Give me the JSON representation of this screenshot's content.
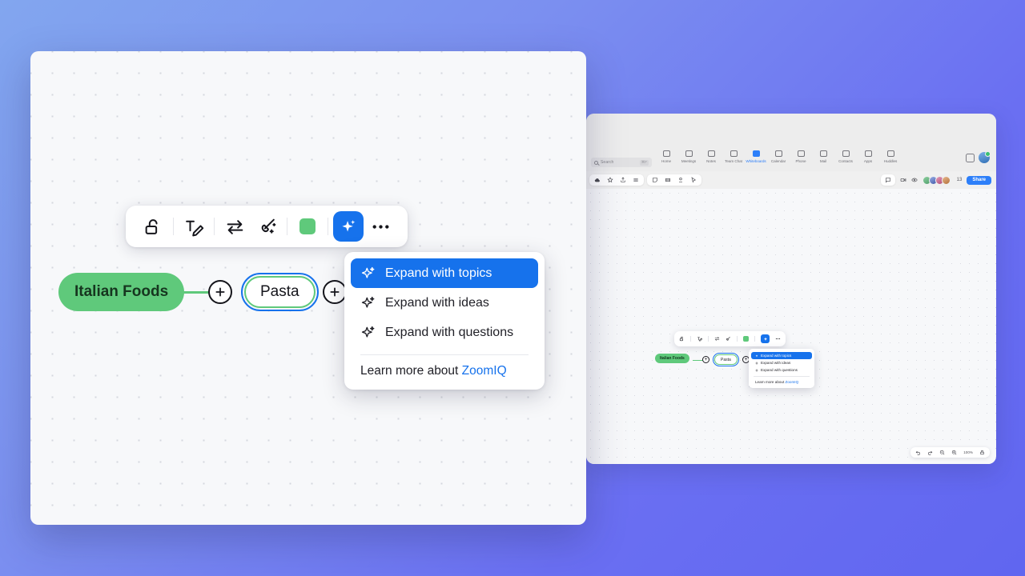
{
  "background_app": {
    "name": "zoom-desktop-app",
    "search": {
      "placeholder": "Search",
      "shortcut": "⌘F"
    },
    "nav_items": [
      {
        "label": "Home",
        "icon": "home-icon",
        "active": false
      },
      {
        "label": "Meetings",
        "icon": "video-icon",
        "active": false
      },
      {
        "label": "Notes",
        "icon": "notes-icon",
        "active": false
      },
      {
        "label": "Team Chat",
        "icon": "chat-icon",
        "active": false
      },
      {
        "label": "Whiteboards",
        "icon": "whiteboard-icon",
        "active": true
      },
      {
        "label": "Calendar",
        "icon": "calendar-icon",
        "active": false
      },
      {
        "label": "Phone",
        "icon": "phone-icon",
        "active": false
      },
      {
        "label": "Mail",
        "icon": "mail-icon",
        "active": false
      },
      {
        "label": "Contacts",
        "icon": "contacts-icon",
        "active": false
      },
      {
        "label": "Apps",
        "icon": "apps-icon",
        "active": false
      },
      {
        "label": "Huddles",
        "icon": "huddles-icon",
        "active": false
      }
    ],
    "share_label": "Share",
    "participant_count": "13",
    "zoom_level": "100%"
  },
  "whiteboard": {
    "toolbar": [
      {
        "name": "unlock-icon",
        "label": "Unlock"
      },
      {
        "name": "text-edit-icon",
        "label": "Edit text"
      },
      {
        "name": "swap-arrows-icon",
        "label": "Swap"
      },
      {
        "name": "magic-brush-icon",
        "label": "Magic brush"
      },
      {
        "name": "color-swatch",
        "label": "Color",
        "color": "#5FC97B"
      },
      {
        "name": "sparkle-ai-icon",
        "label": "AI assist",
        "active": true,
        "color": "#1672EC"
      },
      {
        "name": "more-options-icon",
        "label": "More"
      }
    ],
    "nodes": [
      {
        "label": "Italian Foods",
        "type": "root",
        "color": "#5FC97B"
      },
      {
        "label": "Pasta",
        "type": "child",
        "selected": true,
        "color": "#5FC97B"
      }
    ],
    "add_button_label": "+"
  },
  "ai_menu": {
    "items": [
      {
        "label": "Expand with topics",
        "icon": "sparkle-icon",
        "selected": true
      },
      {
        "label": "Expand with ideas",
        "icon": "sparkle-icon",
        "selected": false
      },
      {
        "label": "Expand with questions",
        "icon": "sparkle-icon",
        "selected": false
      }
    ],
    "footer_text": "Learn more about ",
    "footer_link": "ZoomIQ"
  },
  "colors": {
    "accent_blue": "#1672EC",
    "node_green": "#5FC97B",
    "canvas": "#F7F8FA",
    "page_gradient_start": "#82A6EF",
    "page_gradient_end": "#6066F0"
  }
}
